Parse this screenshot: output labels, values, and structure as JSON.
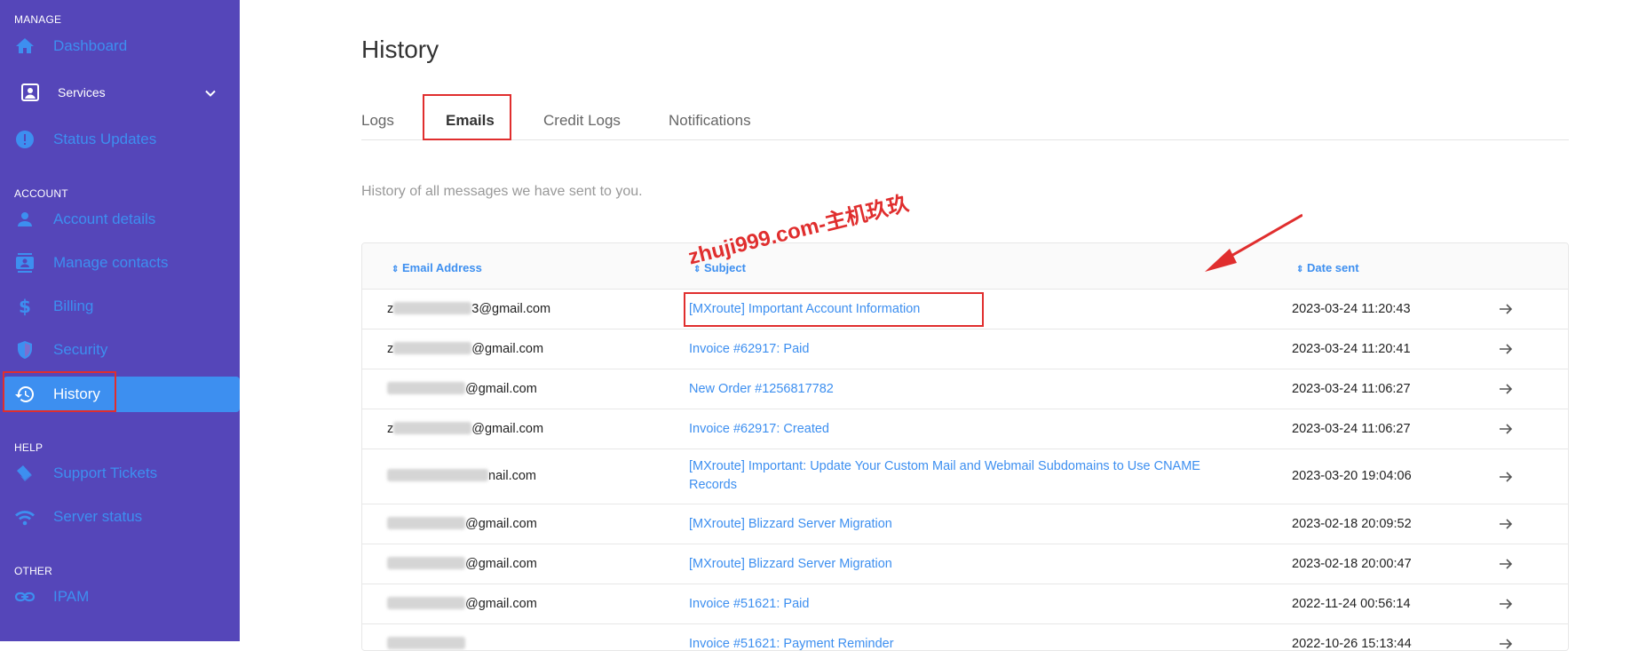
{
  "sidebar": {
    "sections": {
      "manage": "MANAGE",
      "account": "ACCOUNT",
      "help": "HELP",
      "other": "OTHER"
    },
    "items": {
      "dashboard": "Dashboard",
      "services": "Services",
      "status_updates": "Status Updates",
      "account_details": "Account details",
      "manage_contacts": "Manage contacts",
      "billing": "Billing",
      "security": "Security",
      "history": "History",
      "support_tickets": "Support Tickets",
      "server_status": "Server status",
      "ipam": "IPAM"
    },
    "active_item": "history"
  },
  "page": {
    "title": "History",
    "tabs": [
      "Logs",
      "Emails",
      "Credit Logs",
      "Notifications"
    ],
    "active_tab": "Emails",
    "subtitle": "History of all messages we have sent to you."
  },
  "table": {
    "columns": [
      "Email Address",
      "Subject",
      "Date sent"
    ],
    "rows": [
      {
        "email_prefix": "z",
        "email_suffix": "3@gmail.com",
        "subject": "[MXroute] Important Account Information",
        "date": "2023-03-24 11:20:43"
      },
      {
        "email_prefix": "z",
        "email_suffix": "@gmail.com",
        "subject": "Invoice #62917: Paid",
        "date": "2023-03-24 11:20:41"
      },
      {
        "email_prefix": "",
        "email_suffix": "@gmail.com",
        "subject": "New Order #1256817782",
        "date": "2023-03-24 11:06:27"
      },
      {
        "email_prefix": "z",
        "email_suffix": "@gmail.com",
        "subject": "Invoice #62917: Created",
        "date": "2023-03-24 11:06:27"
      },
      {
        "email_prefix": "",
        "email_suffix": "nail.com",
        "subject": "[MXroute] Important: Update Your Custom Mail and Webmail Subdomains to Use CNAME Records",
        "date": "2023-03-20 19:04:06"
      },
      {
        "email_prefix": "",
        "email_suffix": "@gmail.com",
        "subject": "[MXroute] Blizzard Server Migration",
        "date": "2023-02-18 20:09:52"
      },
      {
        "email_prefix": "",
        "email_suffix": "@gmail.com",
        "subject": "[MXroute] Blizzard Server Migration",
        "date": "2023-02-18 20:00:47"
      },
      {
        "email_prefix": "",
        "email_suffix": "@gmail.com",
        "subject": "Invoice #51621: Paid",
        "date": "2022-11-24 00:56:14"
      },
      {
        "email_prefix": "",
        "email_suffix": "",
        "subject": "Invoice #51621: Payment Reminder",
        "date": "2022-10-26 15:13:44"
      }
    ]
  },
  "watermark": {
    "text": "zhuji999.com-主机玖玖"
  },
  "colors": {
    "sidebar_bg": "#5546b9",
    "accent": "#3d8ff0",
    "highlight_box": "#e02e2e"
  }
}
